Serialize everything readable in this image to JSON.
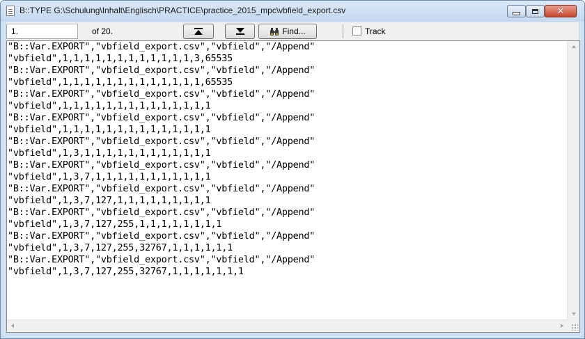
{
  "window": {
    "title": "B::TYPE G:\\Schulung\\Inhalt\\Englisch\\PRACTICE\\practice_2015_mpc\\vbfield_export.csv"
  },
  "toolbar": {
    "line_value": "1.",
    "of_label": "of 20.",
    "find_label": "Find...",
    "track_label": "Track",
    "track_checked": false
  },
  "content": {
    "lines": [
      "\"B::Var.EXPORT\",\"vbfield_export.csv\",\"vbfield\",\"/Append\"",
      "\"vbfield\",1,1,1,1,1,1,1,1,1,1,1,1,3,65535",
      "\"B::Var.EXPORT\",\"vbfield_export.csv\",\"vbfield\",\"/Append\"",
      "\"vbfield\",1,1,1,1,1,1,1,1,1,1,1,1,1,65535",
      "\"B::Var.EXPORT\",\"vbfield_export.csv\",\"vbfield\",\"/Append\"",
      "\"vbfield\",1,1,1,1,1,1,1,1,1,1,1,1,1,1",
      "\"B::Var.EXPORT\",\"vbfield_export.csv\",\"vbfield\",\"/Append\"",
      "\"vbfield\",1,1,1,1,1,1,1,1,1,1,1,1,1,1",
      "\"B::Var.EXPORT\",\"vbfield_export.csv\",\"vbfield\",\"/Append\"",
      "\"vbfield\",1,3,1,1,1,1,1,1,1,1,1,1,1,1",
      "\"B::Var.EXPORT\",\"vbfield_export.csv\",\"vbfield\",\"/Append\"",
      "\"vbfield\",1,3,7,1,1,1,1,1,1,1,1,1,1,1",
      "\"B::Var.EXPORT\",\"vbfield_export.csv\",\"vbfield\",\"/Append\"",
      "\"vbfield\",1,3,7,127,1,1,1,1,1,1,1,1,1",
      "\"B::Var.EXPORT\",\"vbfield_export.csv\",\"vbfield\",\"/Append\"",
      "\"vbfield\",1,3,7,127,255,1,1,1,1,1,1,1,1",
      "\"B::Var.EXPORT\",\"vbfield_export.csv\",\"vbfield\",\"/Append\"",
      "\"vbfield\",1,3,7,127,255,32767,1,1,1,1,1,1",
      "\"B::Var.EXPORT\",\"vbfield_export.csv\",\"vbfield\",\"/Append\"",
      "\"vbfield\",1,3,7,127,255,32767,1,1,1,1,1,1,1"
    ]
  }
}
